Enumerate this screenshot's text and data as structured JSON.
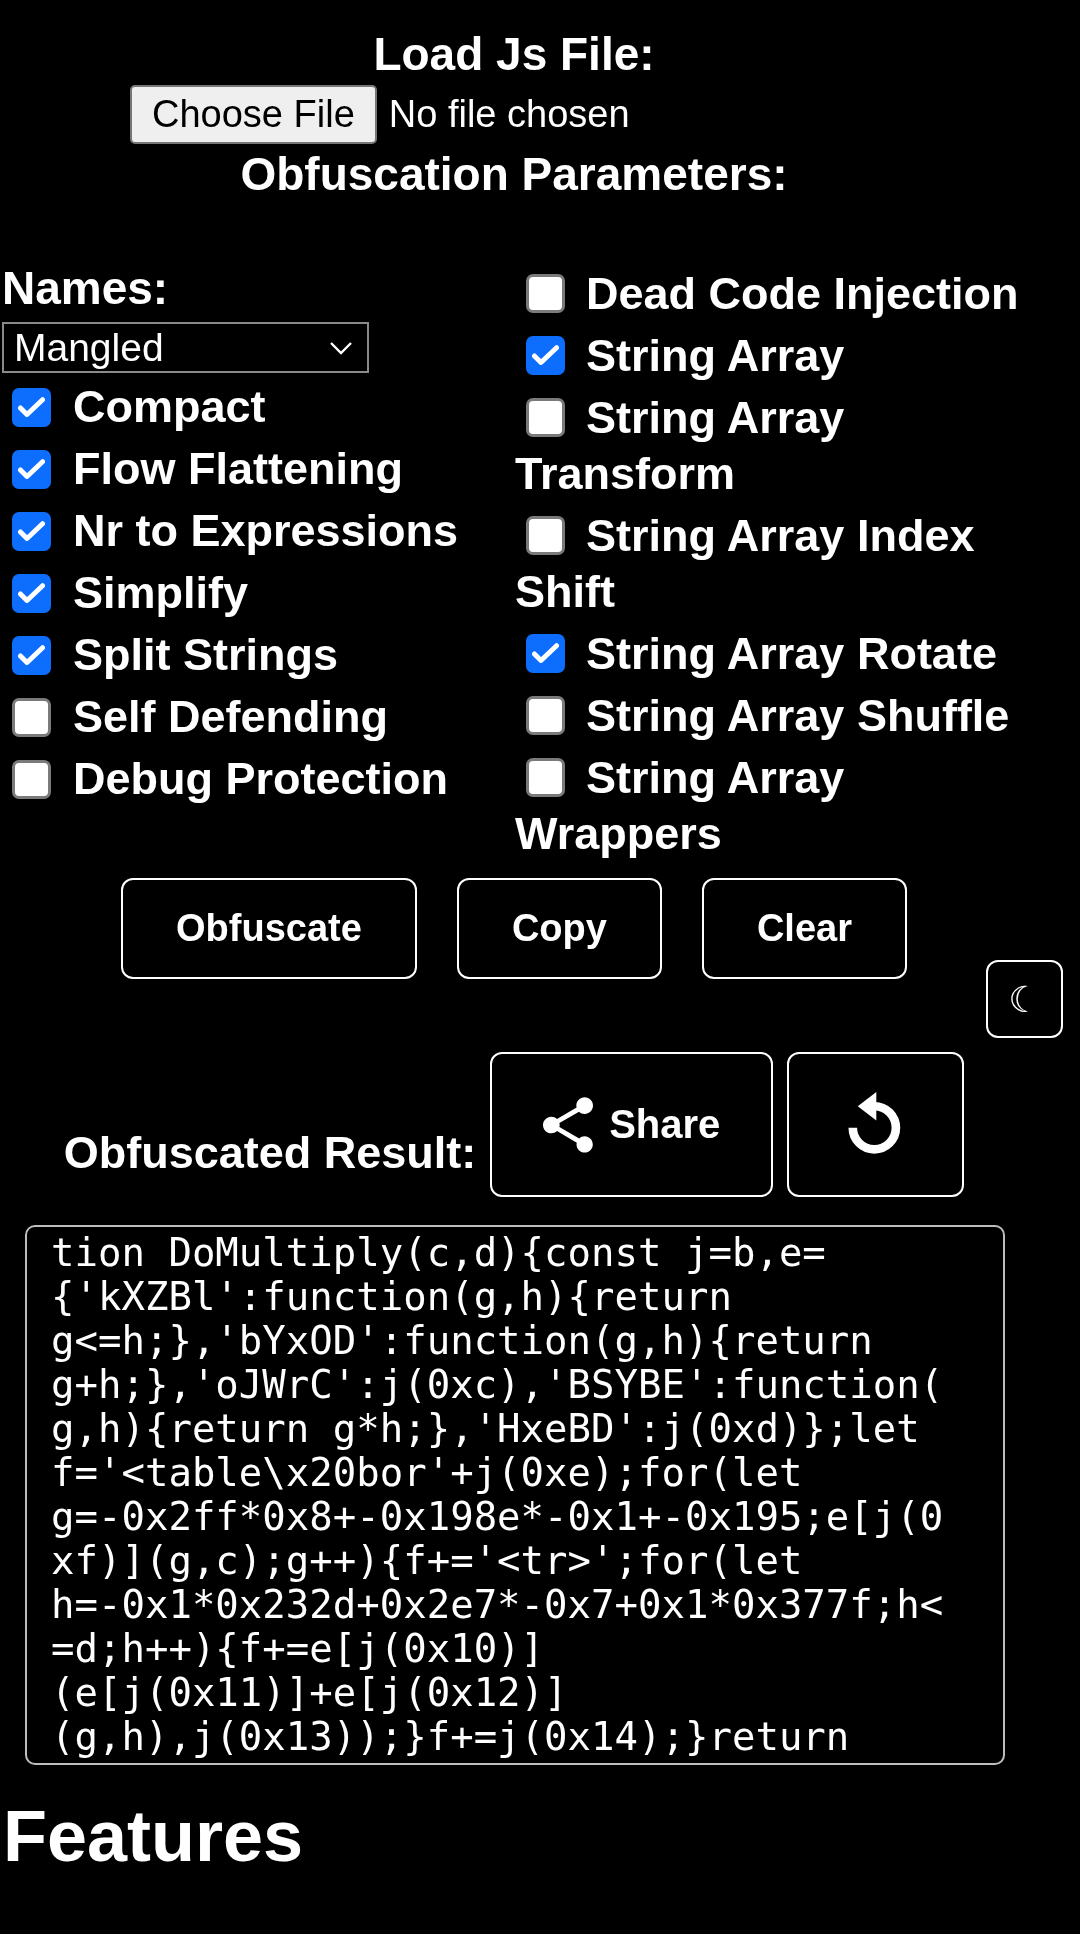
{
  "load_section": {
    "title": "Load Js File:",
    "file_input": {
      "button": "Choose File",
      "status": "No file chosen"
    }
  },
  "parameters": {
    "title": "Obfuscation Parameters:",
    "names": {
      "label": "Names:",
      "value": "Mangled"
    },
    "left_options": [
      {
        "label": "Compact",
        "checked": true
      },
      {
        "label": "Flow Flattening",
        "checked": true
      },
      {
        "label": "Nr to Expressions",
        "checked": true
      },
      {
        "label": "Simplify",
        "checked": true
      },
      {
        "label": "Split Strings",
        "checked": true
      },
      {
        "label": "Self Defending",
        "checked": false
      },
      {
        "label": "Debug Protection",
        "checked": false
      }
    ],
    "right_options": [
      {
        "label": "Dead Code Injection",
        "checked": false
      },
      {
        "label": "String Array",
        "checked": true
      },
      {
        "label": "String Array Transform",
        "checked": false
      },
      {
        "label": "String Array Index Shift",
        "checked": false
      },
      {
        "label": "String Array Rotate",
        "checked": true
      },
      {
        "label": "String Array Shuffle",
        "checked": false
      },
      {
        "label": "String Array Wrappers",
        "checked": false
      }
    ]
  },
  "actions": [
    "Obfuscate",
    "Copy",
    "Clear"
  ],
  "theme_toggle": {
    "symbol": "☾"
  },
  "result": {
    "label": "Obfuscated Result:",
    "share_label": "Share",
    "output_lines": [
      "tion DoMultiply(c,d){const j=b,e=",
      "{'kXZBl':function(g,h){return",
      "g<=h;},'bYxOD':function(g,h){return",
      "g+h;},'oJWrC':j(0xc),'BSYBE':function(",
      "g,h){return g*h;},'HxeBD':j(0xd)};let",
      "f='<table\\x20bor'+j(0xe);for(let",
      "g=-0x2ff*0x8+-0x198e*-0x1+-0x195;e[j(0",
      "xf)](g,c);g++){f+='<tr>';for(let",
      "h=-0x1*0x232d+0x2e7*-0x7+0x1*0x377f;h<",
      "=d;h++){f+=e[j(0x10)]",
      "(e[j(0x11)]+e[j(0x12)]",
      "(g,h),j(0x13));}f+=j(0x14);}return"
    ]
  },
  "features": {
    "title": "Features"
  }
}
